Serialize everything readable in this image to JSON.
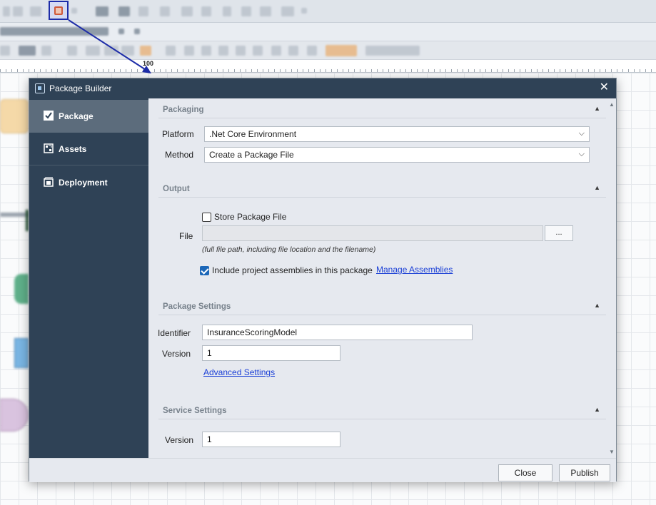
{
  "dialog": {
    "title": "Package Builder",
    "close_glyph": "✕"
  },
  "sidebar": {
    "items": [
      {
        "label": "Package",
        "icon": "checkbox-icon",
        "active": true
      },
      {
        "label": "Assets",
        "icon": "assets-icon",
        "active": false
      },
      {
        "label": "Deployment",
        "icon": "deployment-icon",
        "active": false
      }
    ]
  },
  "sections": {
    "packaging": {
      "title": "Packaging",
      "platform_label": "Platform",
      "platform_value": ".Net Core Environment",
      "method_label": "Method",
      "method_value": "Create a Package File"
    },
    "output": {
      "title": "Output",
      "store_label": "Store Package File",
      "store_checked": false,
      "file_label": "File",
      "file_value": "",
      "browse_label": "...",
      "file_hint": "(full file path, including file location and the filename)",
      "include_label": "Include project assemblies in this package",
      "include_checked": true,
      "manage_link": "Manage Assemblies"
    },
    "package_settings": {
      "title": "Package Settings",
      "identifier_label": "Identifier",
      "identifier_value": "InsuranceScoringModel",
      "version_label": "Version",
      "version_value": "1",
      "advanced_link": "Advanced Settings"
    },
    "service_settings": {
      "title": "Service Settings",
      "version_label": "Version",
      "version_value": "1"
    }
  },
  "footer": {
    "close_label": "Close",
    "publish_label": "Publish"
  },
  "background": {
    "ruler_mark": "100"
  },
  "colors": {
    "titlebar": "#2f4256",
    "sidebar_active": "#5c6c7c",
    "link": "#1a3fd6",
    "checkbox_checked": "#1c67b8",
    "highlight_border": "#1d2ca8"
  }
}
